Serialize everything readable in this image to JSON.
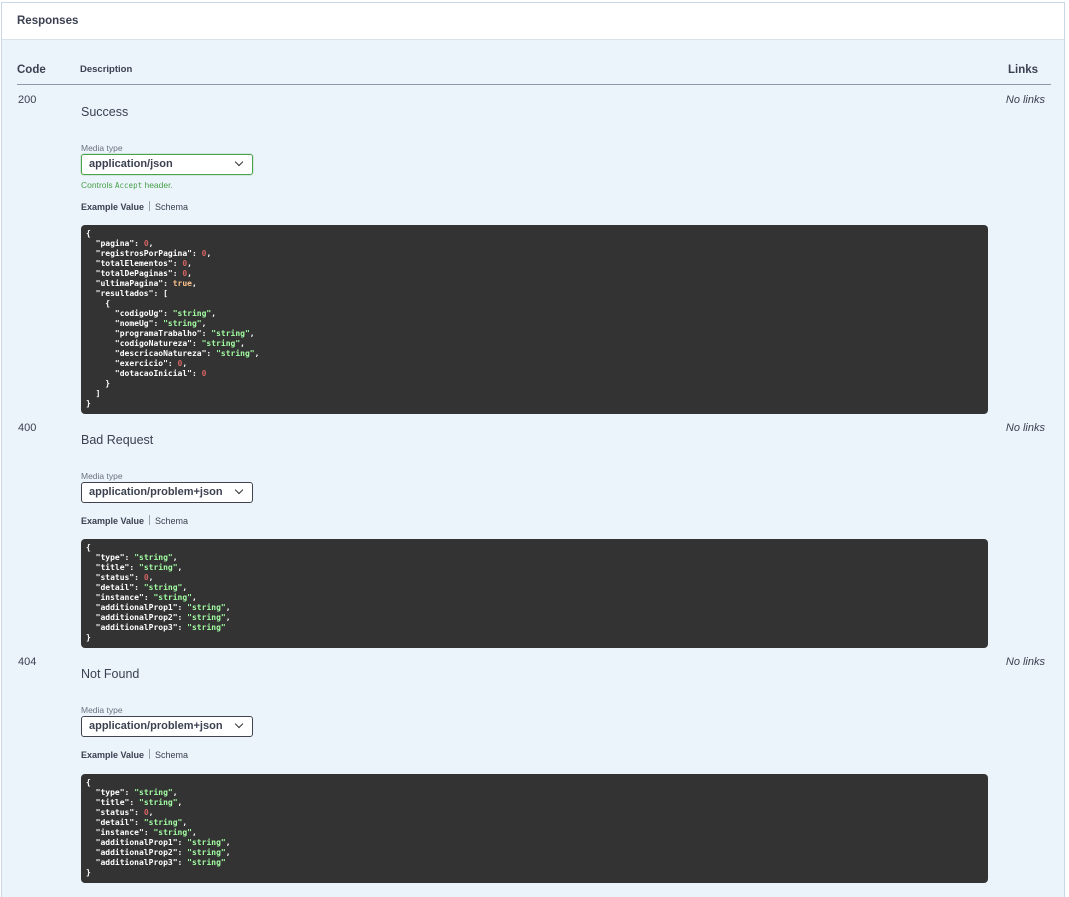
{
  "section": {
    "title": "Responses"
  },
  "columns": {
    "code": "Code",
    "description": "Description",
    "links": "Links"
  },
  "responses": [
    {
      "code": "200",
      "status": "Success",
      "links": "No links",
      "media_label": "Media type",
      "media_value": "application/json",
      "controls": {
        "prefix": "Controls ",
        "code": "Accept",
        "suffix": " header."
      },
      "tab_example": "Example Value",
      "tab_schema": "Schema",
      "example": [
        [
          [
            "p",
            "{"
          ]
        ],
        [
          [
            "p",
            "  "
          ],
          [
            "k",
            "\"pagina\""
          ],
          [
            "p",
            ": "
          ],
          [
            "n",
            "0"
          ],
          [
            "p",
            ","
          ]
        ],
        [
          [
            "p",
            "  "
          ],
          [
            "k",
            "\"registrosPorPagina\""
          ],
          [
            "p",
            ": "
          ],
          [
            "n",
            "0"
          ],
          [
            "p",
            ","
          ]
        ],
        [
          [
            "p",
            "  "
          ],
          [
            "k",
            "\"totalElementos\""
          ],
          [
            "p",
            ": "
          ],
          [
            "n",
            "0"
          ],
          [
            "p",
            ","
          ]
        ],
        [
          [
            "p",
            "  "
          ],
          [
            "k",
            "\"totalDePaginas\""
          ],
          [
            "p",
            ": "
          ],
          [
            "n",
            "0"
          ],
          [
            "p",
            ","
          ]
        ],
        [
          [
            "p",
            "  "
          ],
          [
            "k",
            "\"ultimaPagina\""
          ],
          [
            "p",
            ": "
          ],
          [
            "b",
            "true"
          ],
          [
            "p",
            ","
          ]
        ],
        [
          [
            "p",
            "  "
          ],
          [
            "k",
            "\"resultados\""
          ],
          [
            "p",
            ": ["
          ]
        ],
        [
          [
            "p",
            "    {"
          ]
        ],
        [
          [
            "p",
            "      "
          ],
          [
            "k",
            "\"codigoUg\""
          ],
          [
            "p",
            ": "
          ],
          [
            "s",
            "\"string\""
          ],
          [
            "p",
            ","
          ]
        ],
        [
          [
            "p",
            "      "
          ],
          [
            "k",
            "\"nomeUg\""
          ],
          [
            "p",
            ": "
          ],
          [
            "s",
            "\"string\""
          ],
          [
            "p",
            ","
          ]
        ],
        [
          [
            "p",
            "      "
          ],
          [
            "k",
            "\"programaTrabalho\""
          ],
          [
            "p",
            ": "
          ],
          [
            "s",
            "\"string\""
          ],
          [
            "p",
            ","
          ]
        ],
        [
          [
            "p",
            "      "
          ],
          [
            "k",
            "\"codigoNatureza\""
          ],
          [
            "p",
            ": "
          ],
          [
            "s",
            "\"string\""
          ],
          [
            "p",
            ","
          ]
        ],
        [
          [
            "p",
            "      "
          ],
          [
            "k",
            "\"descricaoNatureza\""
          ],
          [
            "p",
            ": "
          ],
          [
            "s",
            "\"string\""
          ],
          [
            "p",
            ","
          ]
        ],
        [
          [
            "p",
            "      "
          ],
          [
            "k",
            "\"exercicio\""
          ],
          [
            "p",
            ": "
          ],
          [
            "n",
            "0"
          ],
          [
            "p",
            ","
          ]
        ],
        [
          [
            "p",
            "      "
          ],
          [
            "k",
            "\"dotacaoInicial\""
          ],
          [
            "p",
            ": "
          ],
          [
            "n",
            "0"
          ]
        ],
        [
          [
            "p",
            "    }"
          ]
        ],
        [
          [
            "p",
            "  ]"
          ]
        ],
        [
          [
            "p",
            "}"
          ]
        ]
      ]
    },
    {
      "code": "400",
      "status": "Bad Request",
      "links": "No links",
      "media_label": "Media type",
      "media_value": "application/problem+json",
      "tab_example": "Example Value",
      "tab_schema": "Schema",
      "example": [
        [
          [
            "p",
            "{"
          ]
        ],
        [
          [
            "p",
            "  "
          ],
          [
            "k",
            "\"type\""
          ],
          [
            "p",
            ": "
          ],
          [
            "s",
            "\"string\""
          ],
          [
            "p",
            ","
          ]
        ],
        [
          [
            "p",
            "  "
          ],
          [
            "k",
            "\"title\""
          ],
          [
            "p",
            ": "
          ],
          [
            "s",
            "\"string\""
          ],
          [
            "p",
            ","
          ]
        ],
        [
          [
            "p",
            "  "
          ],
          [
            "k",
            "\"status\""
          ],
          [
            "p",
            ": "
          ],
          [
            "n",
            "0"
          ],
          [
            "p",
            ","
          ]
        ],
        [
          [
            "p",
            "  "
          ],
          [
            "k",
            "\"detail\""
          ],
          [
            "p",
            ": "
          ],
          [
            "s",
            "\"string\""
          ],
          [
            "p",
            ","
          ]
        ],
        [
          [
            "p",
            "  "
          ],
          [
            "k",
            "\"instance\""
          ],
          [
            "p",
            ": "
          ],
          [
            "s",
            "\"string\""
          ],
          [
            "p",
            ","
          ]
        ],
        [
          [
            "p",
            "  "
          ],
          [
            "k",
            "\"additionalProp1\""
          ],
          [
            "p",
            ": "
          ],
          [
            "s",
            "\"string\""
          ],
          [
            "p",
            ","
          ]
        ],
        [
          [
            "p",
            "  "
          ],
          [
            "k",
            "\"additionalProp2\""
          ],
          [
            "p",
            ": "
          ],
          [
            "s",
            "\"string\""
          ],
          [
            "p",
            ","
          ]
        ],
        [
          [
            "p",
            "  "
          ],
          [
            "k",
            "\"additionalProp3\""
          ],
          [
            "p",
            ": "
          ],
          [
            "s",
            "\"string\""
          ]
        ],
        [
          [
            "p",
            "}"
          ]
        ]
      ]
    },
    {
      "code": "404",
      "status": "Not Found",
      "links": "No links",
      "media_label": "Media type",
      "media_value": "application/problem+json",
      "tab_example": "Example Value",
      "tab_schema": "Schema",
      "example": [
        [
          [
            "p",
            "{"
          ]
        ],
        [
          [
            "p",
            "  "
          ],
          [
            "k",
            "\"type\""
          ],
          [
            "p",
            ": "
          ],
          [
            "s",
            "\"string\""
          ],
          [
            "p",
            ","
          ]
        ],
        [
          [
            "p",
            "  "
          ],
          [
            "k",
            "\"title\""
          ],
          [
            "p",
            ": "
          ],
          [
            "s",
            "\"string\""
          ],
          [
            "p",
            ","
          ]
        ],
        [
          [
            "p",
            "  "
          ],
          [
            "k",
            "\"status\""
          ],
          [
            "p",
            ": "
          ],
          [
            "n",
            "0"
          ],
          [
            "p",
            ","
          ]
        ],
        [
          [
            "p",
            "  "
          ],
          [
            "k",
            "\"detail\""
          ],
          [
            "p",
            ": "
          ],
          [
            "s",
            "\"string\""
          ],
          [
            "p",
            ","
          ]
        ],
        [
          [
            "p",
            "  "
          ],
          [
            "k",
            "\"instance\""
          ],
          [
            "p",
            ": "
          ],
          [
            "s",
            "\"string\""
          ],
          [
            "p",
            ","
          ]
        ],
        [
          [
            "p",
            "  "
          ],
          [
            "k",
            "\"additionalProp1\""
          ],
          [
            "p",
            ": "
          ],
          [
            "s",
            "\"string\""
          ],
          [
            "p",
            ","
          ]
        ],
        [
          [
            "p",
            "  "
          ],
          [
            "k",
            "\"additionalProp2\""
          ],
          [
            "p",
            ": "
          ],
          [
            "s",
            "\"string\""
          ],
          [
            "p",
            ","
          ]
        ],
        [
          [
            "p",
            "  "
          ],
          [
            "k",
            "\"additionalProp3\""
          ],
          [
            "p",
            ": "
          ],
          [
            "s",
            "\"string\""
          ]
        ],
        [
          [
            "p",
            "}"
          ]
        ]
      ]
    }
  ]
}
